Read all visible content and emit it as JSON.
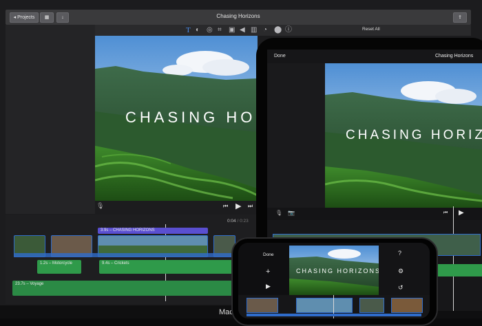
{
  "mac": {
    "titlebar": {
      "projects_label": "◂ Projects",
      "title": "Chasing Horizons"
    },
    "toolbar": {
      "reset_label": "Reset All"
    },
    "viewer": {
      "title_text": "CHASING HO"
    },
    "timecode": {
      "current": "0:04",
      "separator": "/",
      "total": "0:23"
    },
    "timeline": {
      "title_clip": "3.9s – CHASING HORIZONS",
      "audio_clip_1": "1.2s – Motorcycle",
      "audio_clip_2": "9.4s – Crickets",
      "music_track": "23.7s – Voyage"
    },
    "brand_text": "Mac"
  },
  "ipad": {
    "done_label": "Done",
    "title": "Chasing Horizons",
    "viewer_title": "CHASING HORIZ"
  },
  "iphone": {
    "done_label": "Done",
    "viewer_title": "CHASING HORIZONS"
  },
  "colors": {
    "title_clip": "#5a4fd0",
    "video_clip_border": "#2f6ccb",
    "audio_clip": "#2f9a4a",
    "music_track": "#2b8a45",
    "playhead": "#d9d9d9"
  }
}
